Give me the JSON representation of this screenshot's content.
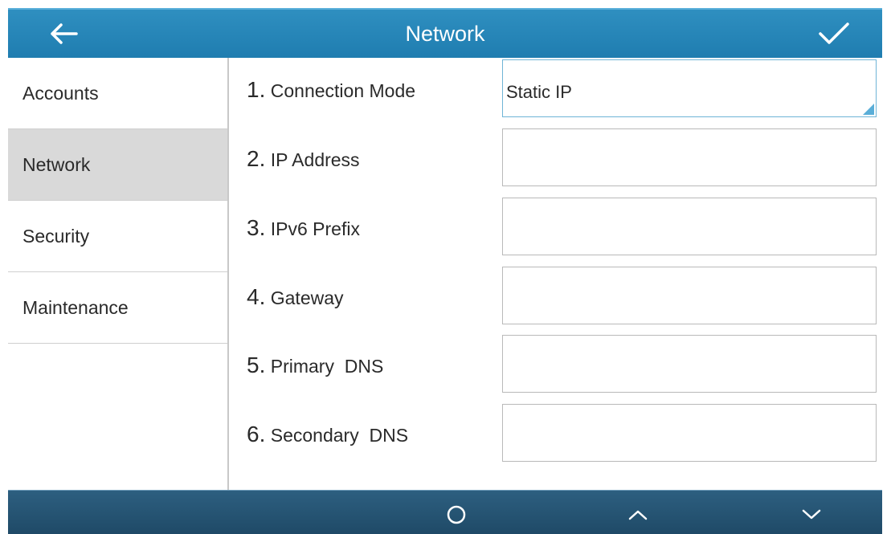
{
  "header": {
    "title": "Network",
    "back_icon": "arrow-left-icon",
    "confirm_icon": "checkmark-icon"
  },
  "sidebar": {
    "items": [
      {
        "label": "Accounts",
        "active": false
      },
      {
        "label": "Network",
        "active": true
      },
      {
        "label": "Security",
        "active": false
      },
      {
        "label": "Maintenance",
        "active": false
      }
    ]
  },
  "form": {
    "rows": [
      {
        "number": "1.",
        "label": "Connection Mode",
        "value": "Static IP"
      },
      {
        "number": "2.",
        "label": "IP Address",
        "value": ""
      },
      {
        "number": "3.",
        "label": "IPv6 Prefix",
        "value": ""
      },
      {
        "number": "4.",
        "label": "Gateway",
        "value": ""
      },
      {
        "number": "5.",
        "label": "Primary  DNS",
        "value": ""
      },
      {
        "number": "6.",
        "label": "Secondary  DNS",
        "value": ""
      }
    ]
  },
  "softkeys": {
    "icons": [
      "circle-icon",
      "chevron-up-icon",
      "chevron-down-icon"
    ]
  },
  "colors": {
    "topbar": "#1f7db0",
    "bottombar": "#244f6d",
    "selected_border": "#6fb4d6",
    "active_item_bg": "#d9d9d9"
  }
}
